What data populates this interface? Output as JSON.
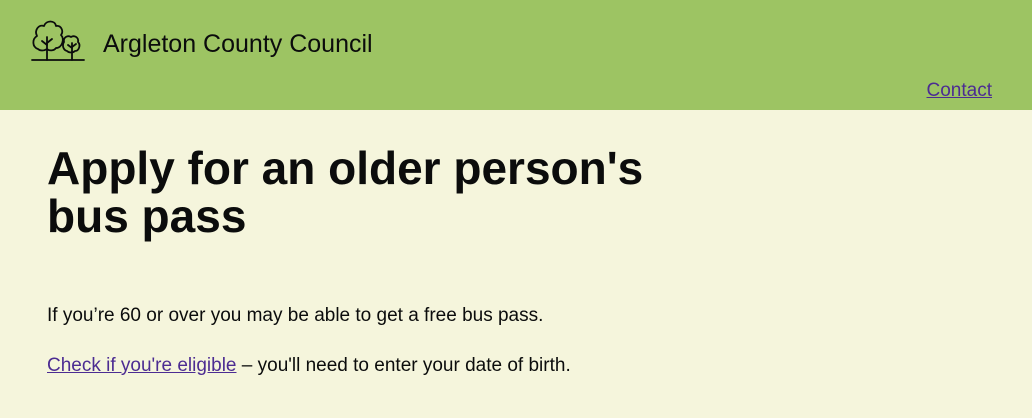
{
  "header": {
    "logo_icon": "trees-icon",
    "site_name": "Argleton County Council",
    "contact_label": "Contact",
    "background_color": "#9dc463"
  },
  "main": {
    "title": "Apply for an older person's bus pass",
    "intro": "If you’re 60 or over you may be able to get a free bus pass.",
    "eligibility_link": "Check if you're eligible",
    "eligibility_suffix": " – you'll need to enter your date of birth.",
    "background_color": "#f5f5dc",
    "link_color": "#4c2c92"
  }
}
